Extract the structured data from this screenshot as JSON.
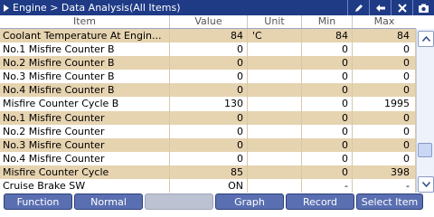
{
  "title": {
    "text": "Engine > Data Analysis(All Items)",
    "icons": [
      "pen-icon",
      "back-arrow-icon",
      "close-icon",
      "camera-icon"
    ]
  },
  "columns": [
    "Item",
    "Value",
    "Unit",
    "Min",
    "Max"
  ],
  "rows": [
    {
      "item": "Coolant Temperature At Engin...",
      "value": "84",
      "unit": "'C",
      "min": "84",
      "max": "84"
    },
    {
      "item": "No.1 Misfire Counter B",
      "value": "0",
      "unit": "",
      "min": "0",
      "max": "0"
    },
    {
      "item": "No.2 Misfire Counter B",
      "value": "0",
      "unit": "",
      "min": "0",
      "max": "0"
    },
    {
      "item": "No.3 Misfire Counter B",
      "value": "0",
      "unit": "",
      "min": "0",
      "max": "0"
    },
    {
      "item": "No.4 Misfire Counter B",
      "value": "0",
      "unit": "",
      "min": "0",
      "max": "0"
    },
    {
      "item": "Misfire Counter Cycle B",
      "value": "130",
      "unit": "",
      "min": "0",
      "max": "1995"
    },
    {
      "item": "No.1 Misfire Counter",
      "value": "0",
      "unit": "",
      "min": "0",
      "max": "0"
    },
    {
      "item": "No.2 Misfire Counter",
      "value": "0",
      "unit": "",
      "min": "0",
      "max": "0"
    },
    {
      "item": "No.3 Misfire Counter",
      "value": "0",
      "unit": "",
      "min": "0",
      "max": "0"
    },
    {
      "item": "No.4 Misfire Counter",
      "value": "0",
      "unit": "",
      "min": "0",
      "max": "0"
    },
    {
      "item": "Misfire Counter Cycle",
      "value": "85",
      "unit": "",
      "min": "0",
      "max": "398"
    },
    {
      "item": "Cruise Brake SW",
      "value": "ON",
      "unit": "",
      "min": "-",
      "max": "-"
    }
  ],
  "toolbar": {
    "function": "Function",
    "normal": "Normal",
    "blank": "",
    "graph": "Graph",
    "record": "Record",
    "select_item": "Select Item"
  },
  "colors": {
    "title_bg": "#1f3b86",
    "row_alt": "#e6d3b0",
    "button_bg": "#5a6fb1"
  }
}
